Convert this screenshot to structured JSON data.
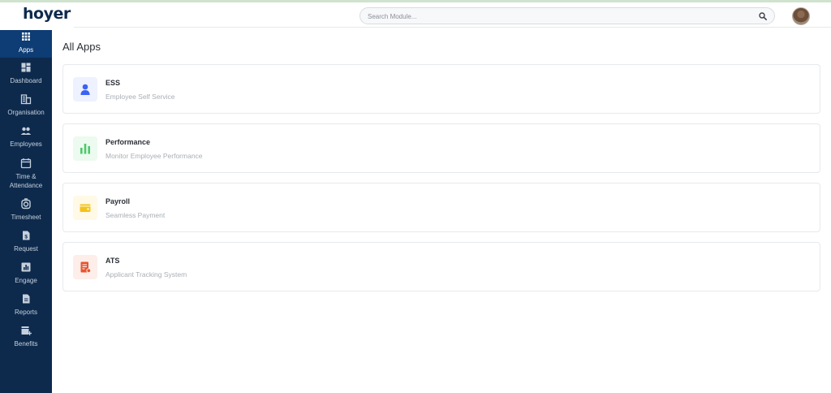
{
  "header": {
    "logo": "hoyer",
    "search_placeholder": "Search Module..."
  },
  "sidebar": {
    "items": [
      {
        "label": "Apps",
        "icon": "grid-icon",
        "active": true
      },
      {
        "label": "Dashboard",
        "icon": "dashboard-icon",
        "active": false
      },
      {
        "label": "Organisation",
        "icon": "building-icon",
        "active": false
      },
      {
        "label": "Employees",
        "icon": "people-icon",
        "active": false
      },
      {
        "label": "Time & Attendance",
        "icon": "calendar-icon",
        "active": false
      },
      {
        "label": "Timesheet",
        "icon": "timer-icon",
        "active": false
      },
      {
        "label": "Request",
        "icon": "request-doc-icon",
        "active": false
      },
      {
        "label": "Engage",
        "icon": "bar-chart-icon",
        "active": false
      },
      {
        "label": "Reports",
        "icon": "report-icon",
        "active": false
      },
      {
        "label": "Benefits",
        "icon": "store-icon",
        "active": false
      }
    ]
  },
  "main": {
    "title": "All Apps",
    "apps": [
      {
        "name": "ESS",
        "description": "Employee Self Service",
        "icon": "person-icon",
        "color": "#3b63f3",
        "tile_bg": "#eef1fe"
      },
      {
        "name": "Performance",
        "description": "Monitor Employee Performance",
        "icon": "performance-chart-icon",
        "color": "#4cc96b",
        "tile_bg": "#ecfaef"
      },
      {
        "name": "Payroll",
        "description": "Seamless Payment",
        "icon": "wallet-icon",
        "color": "#f4c21a",
        "tile_bg": "#fff9e6"
      },
      {
        "name": "ATS",
        "description": "Applicant Tracking System",
        "icon": "applicant-doc-icon",
        "color": "#e8552f",
        "tile_bg": "#fdeeea"
      }
    ]
  },
  "colors": {
    "sidebar_bg": "#0d2a4d",
    "sidebar_active": "#0e3c74"
  }
}
